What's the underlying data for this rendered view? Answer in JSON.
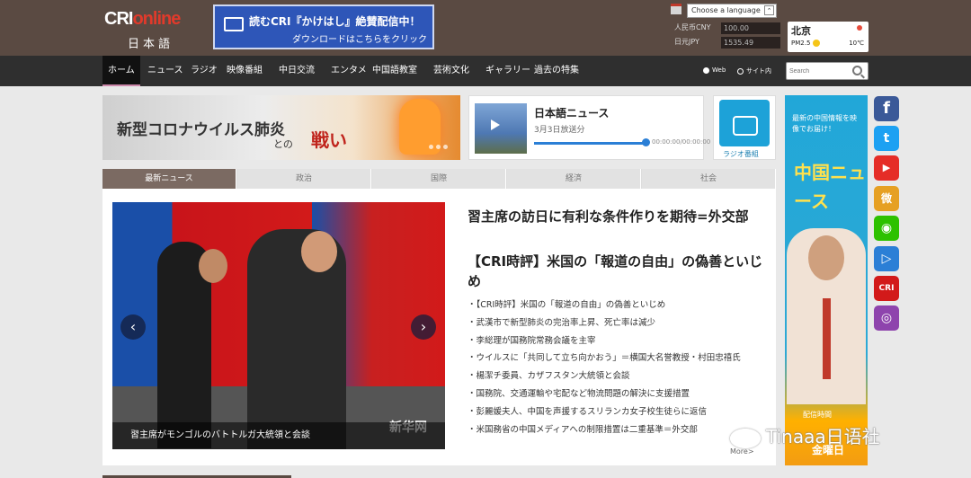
{
  "header": {
    "logo_main_a": "CRI",
    "logo_main_b": "online",
    "logo_sub": "日本語",
    "banner_line1": "読むCRI『かけはし』絶賛配信中！",
    "banner_line2": "ダウンロードはこちらをクリック",
    "language_select": "Choose a language",
    "rates": [
      {
        "label": "人民币CNY",
        "value": "100.00"
      },
      {
        "label": "日元JPY",
        "value": "1535.49"
      }
    ],
    "weather": {
      "city": "北京",
      "pm": "PM2.5",
      "temp": "10℃"
    }
  },
  "nav": {
    "items": [
      "ホーム",
      "ニュース",
      "ラジオ",
      "映像番組",
      "中日交流",
      "エンタメ",
      "中国語教室",
      "芸術文化",
      "ギャラリー",
      "過去の特集"
    ],
    "radio_web": "Web",
    "radio_site": "サイト内",
    "search_placeholder": "Search"
  },
  "promo": {
    "covid_line1": "新型コロナウイルス肺炎",
    "covid_line2": "との",
    "covid_line3": "戦い",
    "player_title": "日本語ニュース",
    "player_date": "3月3日放送分",
    "player_time": "00:00:00/00:00:00",
    "radio_tile_label": "ラジオ番組"
  },
  "tabs": [
    "最新ニュース",
    "政治",
    "国際",
    "経済",
    "社会"
  ],
  "main": {
    "photo_caption": "習主席がモンゴルのバトトルガ大統領と会談",
    "photo_watermark": "新华网",
    "headline1": "習主席の訪日に有利な条件作りを期待=外交部",
    "headline2": "【CRI時評】米国の「報道の自由」の偽善といじめ",
    "list": [
      "・【CRI時評】米国の「報道の自由」の偽善といじめ",
      "・武漢市で新型肺炎の完治率上昇、死亡率は減少",
      "・李総理が国務院常務会議を主宰",
      "・ウイルスに「共同して立ち向かおう」＝横国大名誉教授・村田忠禧氏",
      "・楊潔チ委員、カザフスタン大統領と会談",
      "・国務院、交通運輸や宅配など物流問題の解決に支援措置",
      "・彭麗媛夫人、中国を声援するスリランカ女子校生徒らに返信",
      "・米国務省の中国メディアへの制限措置は二重基準＝外交部"
    ],
    "more": "More>"
  },
  "side_ad": {
    "line1": "最新の中国情報を映像でお届け！",
    "title": "中国ニュース",
    "schedule_label": "配信時間",
    "schedule_day": "金曜日"
  },
  "social": [
    {
      "name": "facebook-icon",
      "glyph": "f",
      "color": "#3b5998"
    },
    {
      "name": "twitter-icon",
      "glyph": "t",
      "color": "#1da1f2"
    },
    {
      "name": "youtube-icon",
      "glyph": "▶",
      "color": "#e52d27"
    },
    {
      "name": "weibo-icon",
      "glyph": "微",
      "color": "#e6a023"
    },
    {
      "name": "wechat-icon",
      "glyph": "◉",
      "color": "#2dc100"
    },
    {
      "name": "play-icon",
      "glyph": "▷",
      "color": "#2b7fd6"
    },
    {
      "name": "cri-icon",
      "glyph": "CRI",
      "color": "#d21a1a"
    },
    {
      "name": "podcast-icon",
      "glyph": "◎",
      "color": "#8e44ad"
    }
  ],
  "watermark": "Tinaaa日语社"
}
